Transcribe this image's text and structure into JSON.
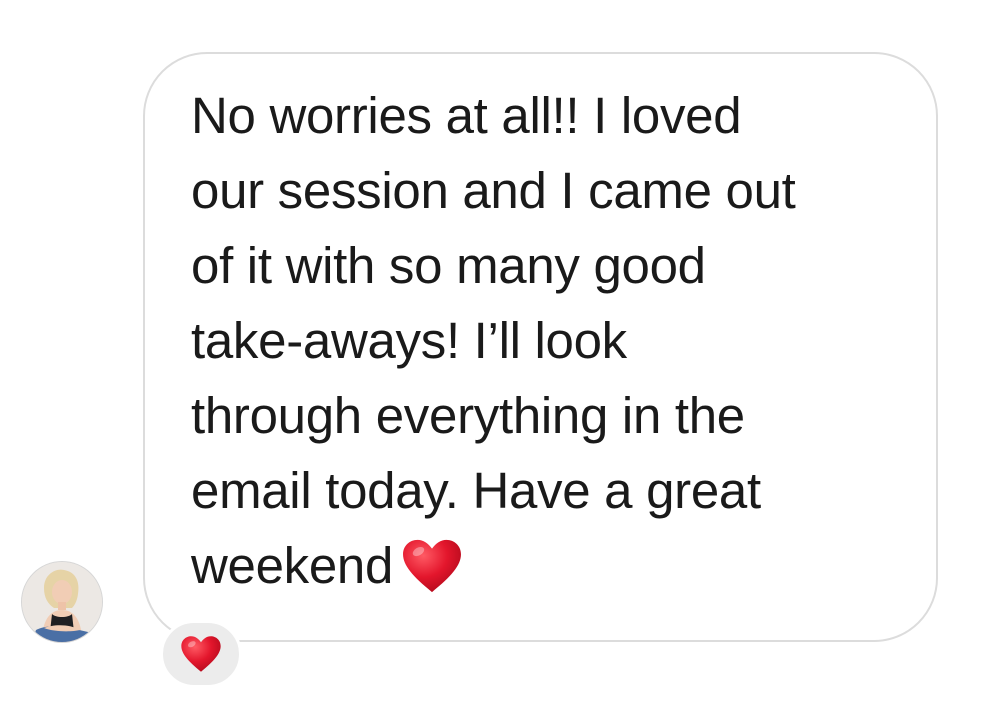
{
  "message": {
    "lines": [
      "No worries at all!! I loved",
      "our session and I came out",
      "of it with so many good",
      "take-aways! I’ll look",
      "through everything in the",
      "email today. Have a great",
      "weekend"
    ],
    "inline_emoji": "red-heart"
  },
  "reaction": {
    "emoji": "red-heart"
  },
  "sender": {
    "avatar": "avatar-photo"
  },
  "colors": {
    "bubble_border": "#dcdcdc",
    "text": "#1a1a1a",
    "heart": "#e0142b",
    "reaction_pill": "#ececec"
  }
}
